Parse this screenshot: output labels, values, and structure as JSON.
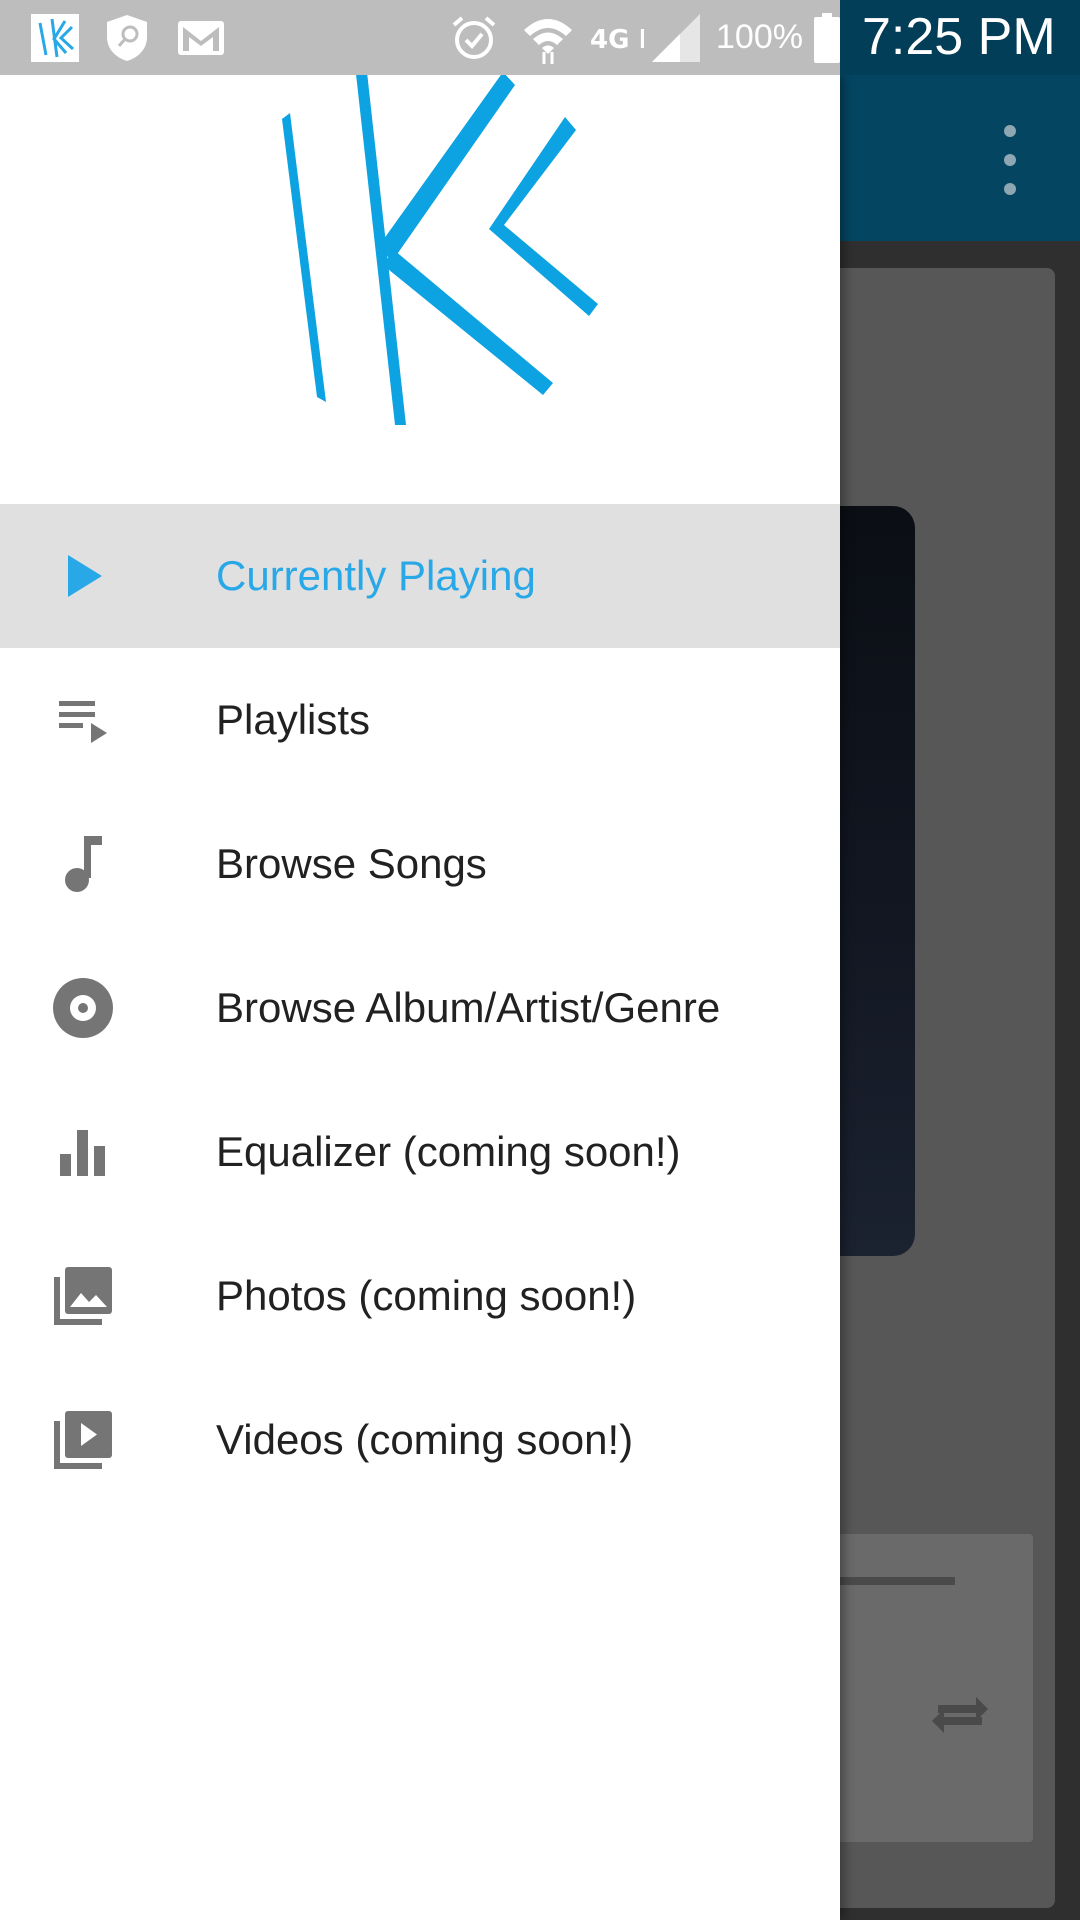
{
  "colors": {
    "accent": "#29a8e8",
    "toolbar": "#044662",
    "drawer_background": "#ffffff",
    "active_item_background": "#e0e0e0",
    "icon_gray": "#757575",
    "text_primary": "#212121"
  },
  "status_bar": {
    "icons_left": [
      "app-logo-icon",
      "shield-search-icon",
      "gmail-icon"
    ],
    "icons_right": [
      "alarm-icon",
      "wifi-icon",
      "lte-icon",
      "signal-icon",
      "battery-icon"
    ],
    "network": "4G LTE",
    "battery": "100%",
    "time": "7:25 PM"
  },
  "drawer": {
    "logo": "app-logo",
    "items": [
      {
        "label": "Currently Playing",
        "icon": "play-icon",
        "active": true
      },
      {
        "label": "Playlists",
        "icon": "playlist-icon",
        "active": false
      },
      {
        "label": "Browse Songs",
        "icon": "music-note-icon",
        "active": false
      },
      {
        "label": "Browse Album/Artist/Genre",
        "icon": "album-icon",
        "active": false
      },
      {
        "label": "Equalizer (coming soon!)",
        "icon": "equalizer-icon",
        "active": false
      },
      {
        "label": "Photos (coming soon!)",
        "icon": "photo-library-icon",
        "active": false
      },
      {
        "label": "Videos (coming soon!)",
        "icon": "video-library-icon",
        "active": false
      }
    ]
  },
  "background_app": {
    "toolbar_menu": "more-vert-icon",
    "repeat_button": "repeat-icon"
  }
}
